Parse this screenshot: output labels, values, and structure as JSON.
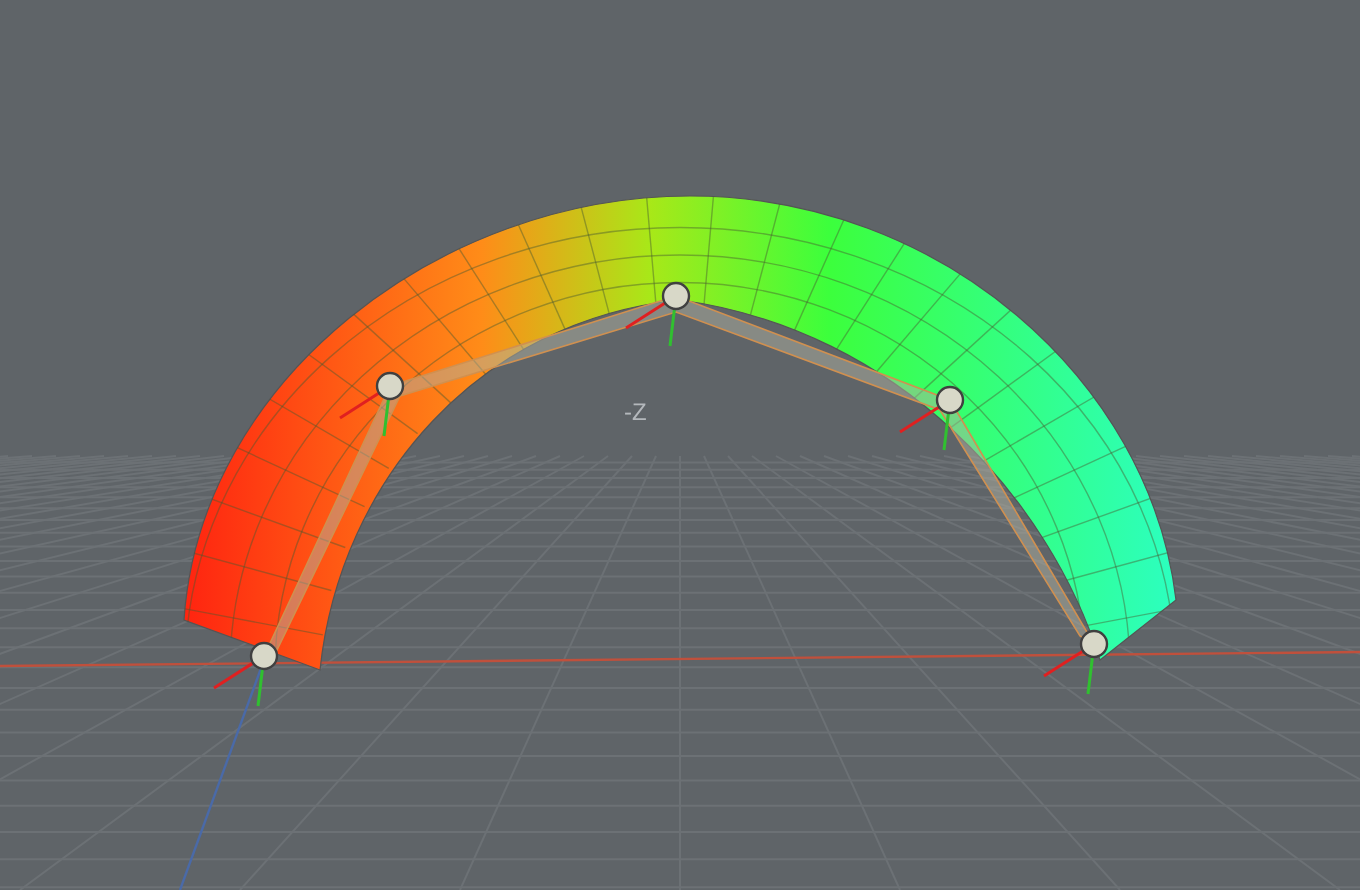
{
  "viewport": {
    "axis_label": "-Z"
  }
}
